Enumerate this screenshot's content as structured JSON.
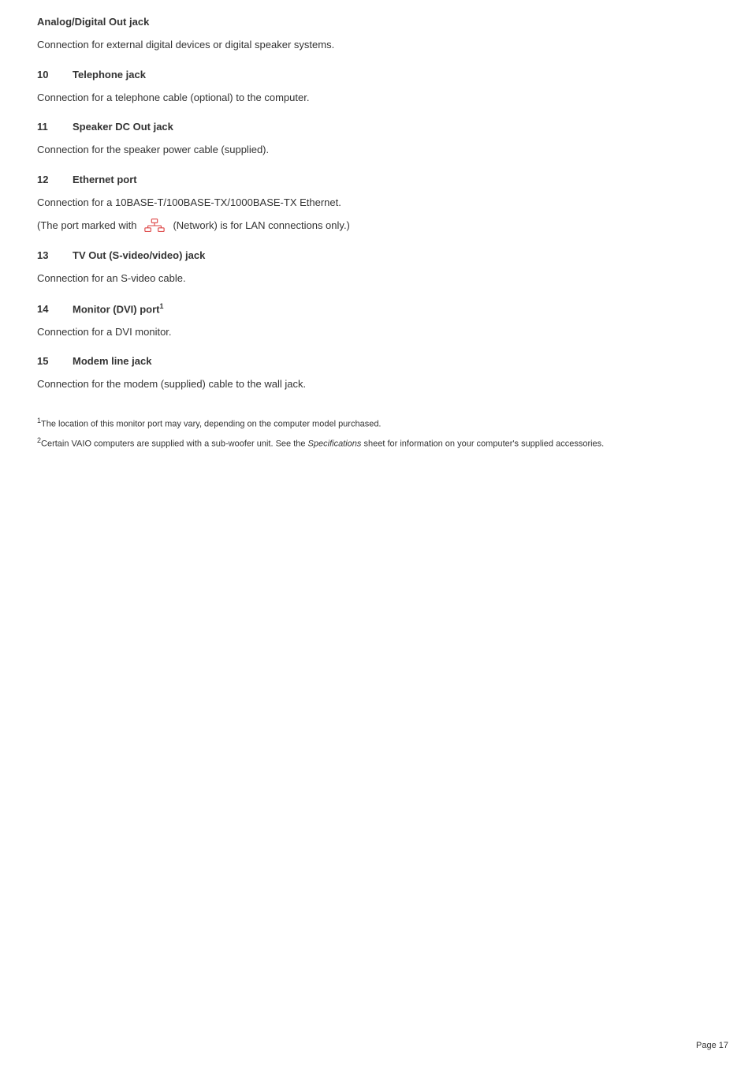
{
  "page": {
    "number": "Page 17"
  },
  "top_section": {
    "title": "Analog/Digital Out jack",
    "body": "Connection for external digital devices or digital speaker systems."
  },
  "sections": [
    {
      "number": "10",
      "title": "Telephone jack",
      "body": "Connection for a telephone cable (optional) to the computer."
    },
    {
      "number": "11",
      "title": "Speaker DC Out jack",
      "body": "Connection for the speaker power cable (supplied)."
    },
    {
      "number": "12",
      "title": "Ethernet port",
      "body": "Connection for a 10BASE-T/100BASE-TX/1000BASE-TX Ethernet.",
      "note": "(The port marked with  (Network) is for LAN connections only.)"
    },
    {
      "number": "13",
      "title": "TV Out (S-video/video) jack",
      "body": "Connection for an S-video cable."
    },
    {
      "number": "14",
      "title": "Monitor (DVI) port",
      "title_sup": "1",
      "body": "Connection for a DVI monitor."
    },
    {
      "number": "15",
      "title": "Modem line jack",
      "body": "Connection for the modem (supplied) cable to the wall jack."
    }
  ],
  "footnotes": [
    {
      "ref": "1",
      "text": "The location of this  monitor port may vary, depending on the computer model purchased."
    },
    {
      "ref": "2",
      "text_before": "Certain VAIO computers are supplied with a sub-woofer unit. See the ",
      "text_italic": "Specifications",
      "text_after": " sheet for information on your computer's supplied accessories."
    }
  ]
}
